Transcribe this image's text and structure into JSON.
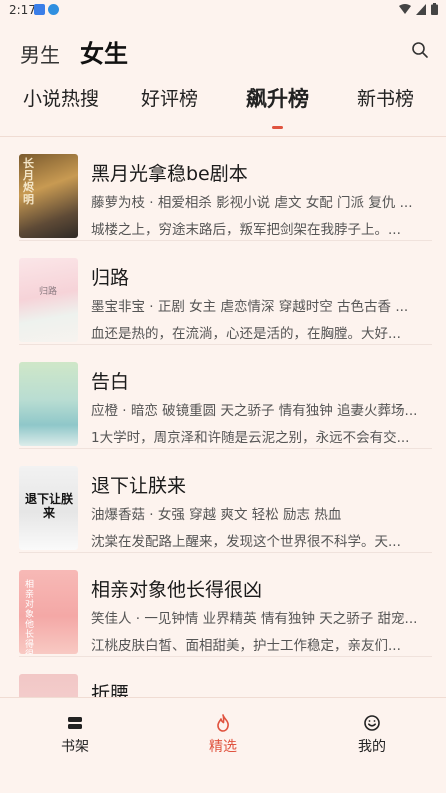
{
  "status_bar": {
    "time": "2:17"
  },
  "header": {
    "gender_tabs": [
      {
        "label": "男生"
      },
      {
        "label": "女生"
      }
    ]
  },
  "rank_tabs": [
    {
      "label": "小说热搜"
    },
    {
      "label": "好评榜"
    },
    {
      "label": "飙升榜"
    },
    {
      "label": "新书榜"
    }
  ],
  "books": [
    {
      "title": "黑月光拿稳be剧本",
      "tags": "藤萝为枝 · 相爱相杀 影视小说 虐文 女配 门派 复仇 ...",
      "desc": "城楼之上，穷途末路后，叛军把剑架在我脖子上。...",
      "cover_text": "长月烬明"
    },
    {
      "title": "归路",
      "tags": "墨宝非宝 · 正剧 女主 虐恋情深 穿越时空 古色古香 ...",
      "desc": "血还是热的，在流淌，心还是活的，在胸膛。大好...",
      "cover_text": "归路"
    },
    {
      "title": "告白",
      "tags": "应橙 · 暗恋 破镜重圆 天之骄子 情有独钟 追妻火葬场...",
      "desc": "1大学时，周京泽和许随是云泥之别，永远不会有交...",
      "cover_text": ""
    },
    {
      "title": "退下让朕来",
      "tags": "油爆香菇 · 女强 穿越 爽文 轻松 励志 热血",
      "desc": "沈棠在发配路上醒来，发现这个世界很不科学。天...",
      "cover_text": "退下让朕来"
    },
    {
      "title": "相亲对象他长得很凶",
      "tags": "笑佳人 · 一见钟情 业界精英 情有独钟 天之骄子 甜宠...",
      "desc": "江桃皮肤白皙、面相甜美，护士工作稳定，亲友们...",
      "cover_text": "相亲对象他长得很凶"
    },
    {
      "title": "折腰",
      "tags": "",
      "desc": "",
      "cover_text": ""
    }
  ],
  "bottom_nav": [
    {
      "label": "书架",
      "icon": "bookshelf-icon"
    },
    {
      "label": "精选",
      "icon": "flame-icon"
    },
    {
      "label": "我的",
      "icon": "smile-icon"
    }
  ],
  "colors": {
    "accent": "#e0533f",
    "background": "#fdf3ee"
  }
}
